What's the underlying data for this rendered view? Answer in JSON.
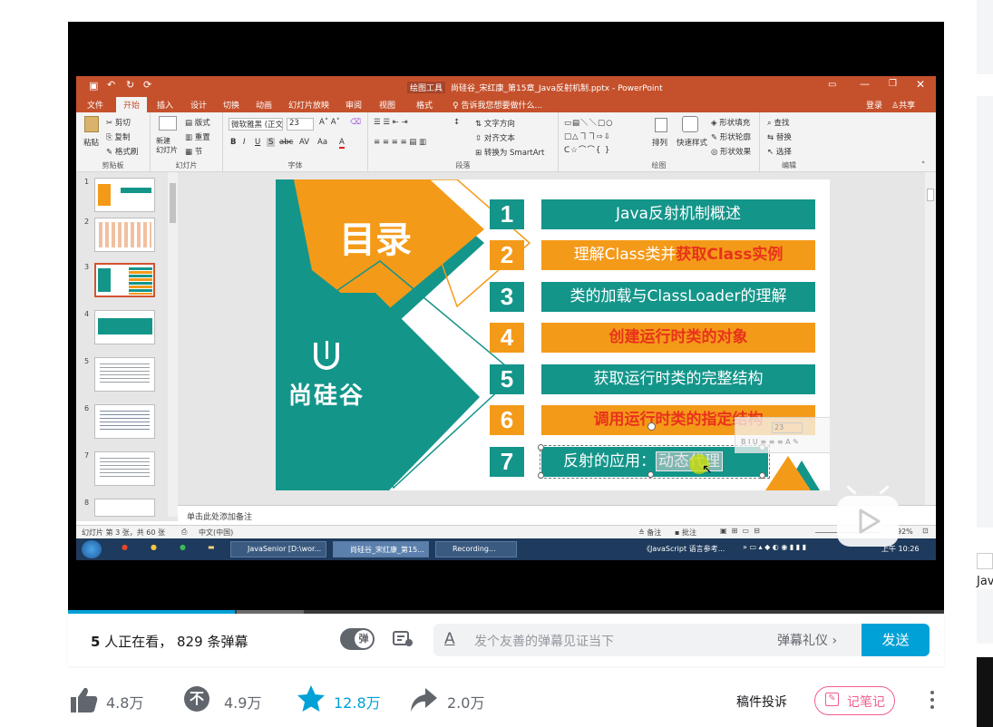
{
  "ppt": {
    "window_title": "尚硅谷_宋红康_第15章_Java反射机制.pptx - PowerPoint",
    "drawing_tools": "绘图工具",
    "tabs": [
      "文件",
      "开始",
      "插入",
      "设计",
      "切换",
      "动画",
      "幻灯片放映",
      "审阅",
      "视图",
      "格式"
    ],
    "tell_me": "告诉我您想要做什么...",
    "login": "登录",
    "share": "共享",
    "ribbon": {
      "clipboard": {
        "paste": "粘贴",
        "cut": "剪切",
        "copy": "复制",
        "format_painter": "格式刷",
        "label": "剪贴板"
      },
      "slides": {
        "new_slide": "新建\n幻灯片",
        "layout": "版式",
        "reset": "重置",
        "section": "节",
        "label": "幻灯片"
      },
      "font": {
        "name": "微软雅黑 (正文)",
        "size": "23",
        "label": "字体"
      },
      "paragraph": {
        "text_direction": "文字方向",
        "align_text": "对齐文本",
        "convert_smartart": "转换为 SmartArt",
        "label": "段落"
      },
      "drawing": {
        "arrange": "排列",
        "quick_styles": "快速样式",
        "shape_fill": "形状填充",
        "shape_outline": "形状轮廓",
        "shape_effects": "形状效果",
        "label": "绘图"
      },
      "editing": {
        "find": "查找",
        "replace": "替换",
        "select": "选择",
        "label": "编辑"
      }
    },
    "thumb_numbers": [
      "1",
      "2",
      "3",
      "4",
      "5",
      "6",
      "7",
      "8"
    ],
    "notes_placeholder": "单击此处添加备注",
    "status": {
      "slide_info": "幻灯片 第 3 张，共 60 张",
      "lang": "中文(中国)",
      "notes": "备注",
      "comments": "批注",
      "zoom": "92%"
    },
    "taskbar": {
      "items": [
        "JavaSenior [D:\\wor...",
        "尚硅谷_宋红康_第15...",
        "Recording..."
      ],
      "tray_text": "《JavaScript 语言参考...",
      "time": "上午 10:26"
    },
    "slide": {
      "heading": "目录",
      "brand": "尚硅谷",
      "items": [
        {
          "num": "1",
          "parts": [
            {
              "t": "Java反射机制概述",
              "hl": false
            }
          ],
          "style": "teal"
        },
        {
          "num": "2",
          "parts": [
            {
              "t": "理解Class类并",
              "hl": false
            },
            {
              "t": "获取Class实例",
              "hl": true
            }
          ],
          "style": "orange"
        },
        {
          "num": "3",
          "parts": [
            {
              "t": "类的加载与ClassLoader的理解",
              "hl": false
            }
          ],
          "style": "teal"
        },
        {
          "num": "4",
          "parts": [
            {
              "t": "创建运行时类的对象",
              "hl": true
            }
          ],
          "style": "orange"
        },
        {
          "num": "5",
          "parts": [
            {
              "t": "获取运行时类的完整结构",
              "hl": false
            }
          ],
          "style": "teal"
        },
        {
          "num": "6",
          "parts": [
            {
              "t": "调用运行时类的指定结构",
              "hl": true
            }
          ],
          "style": "orange"
        },
        {
          "num": "7",
          "parts": [
            {
              "t": "反射的应用：",
              "hl": false
            },
            {
              "t": "动态代理",
              "hl": false
            }
          ],
          "style": "teal"
        }
      ],
      "mini_toolbar_size": "23"
    }
  },
  "viewer": {
    "watching_count": "5",
    "watching_text": "人正在看，",
    "danmu_count": "829",
    "danmu_text": "条弹幕",
    "danmu_toggle": "弹",
    "danmu_placeholder": "发个友善的弹幕见证当下",
    "danmu_etiquette": "弹幕礼仪",
    "send": "发送",
    "progress_fraction": 0.19
  },
  "actions": {
    "like": "4.8万",
    "dislike": "4.9万",
    "favorite": "12.8万",
    "share": "2.0万",
    "report": "稿件投诉",
    "notes": "记笔记",
    "dislike_glyph": "不"
  },
  "side": {
    "partial_text": "Jav"
  },
  "colors": {
    "accent": "#00a1d6",
    "ppt_orange": "#c5512c",
    "teal": "#14958a",
    "orange": "#f49a19",
    "highlight_red": "#e8331b",
    "notes_pink": "#f25d8e"
  }
}
